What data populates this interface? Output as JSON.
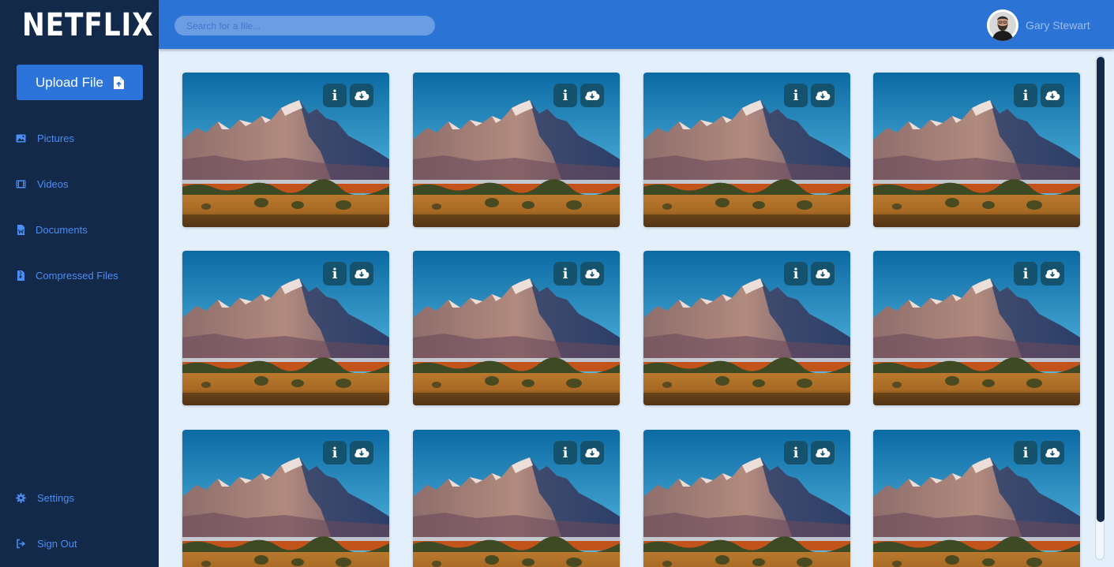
{
  "app": {
    "logo_text": "NETFLIX",
    "colors": {
      "sidebar": "#13294a",
      "header": "#2c73d6",
      "accent": "#2c74d9",
      "nav_text": "#4b8df0",
      "background": "#e3effb"
    }
  },
  "sidebar": {
    "upload_label": "Upload File",
    "upload_icon": "file-upload-icon",
    "nav": [
      {
        "label": "Pictures",
        "icon": "image-icon"
      },
      {
        "label": "Videos",
        "icon": "film-icon"
      },
      {
        "label": "Documents",
        "icon": "word-document-icon"
      },
      {
        "label": "Compressed Files",
        "icon": "archive-file-icon"
      }
    ],
    "bottom": [
      {
        "label": "Settings",
        "icon": "gear-icon"
      },
      {
        "label": "Sign Out",
        "icon": "sign-out-icon"
      }
    ]
  },
  "header": {
    "search_placeholder": "Search for a file...",
    "user_name": "Gary Stewart"
  },
  "files": {
    "info_label": "i",
    "info_icon": "info-icon",
    "download_icon": "cloud-download-icon",
    "thumbnail": "mountain-landscape-image",
    "count": 12
  }
}
